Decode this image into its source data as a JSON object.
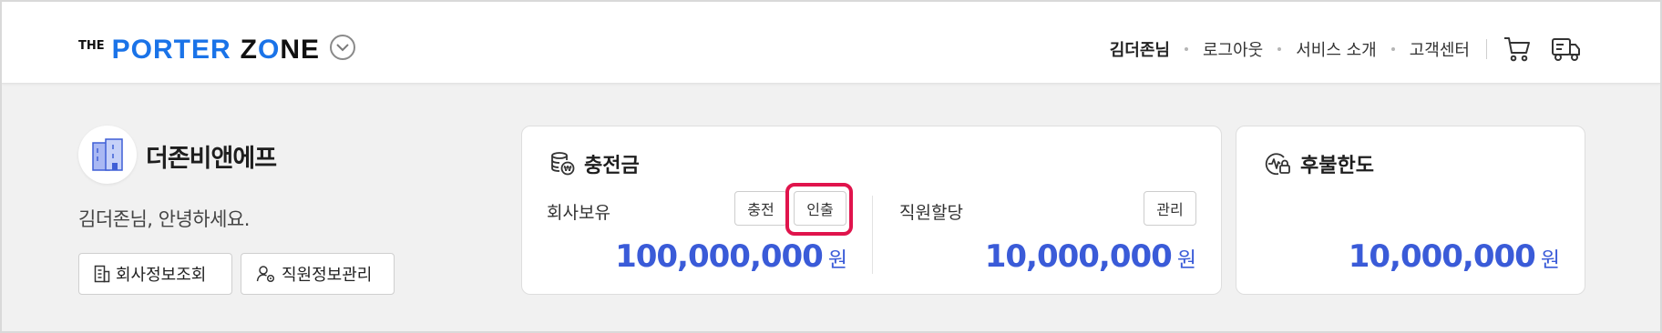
{
  "header": {
    "logo": {
      "the": "THE",
      "porter": "PORTER",
      "zone_z": "Z",
      "zone_o": "O",
      "zone_ne": "NE"
    },
    "nav": {
      "user_label": "김더존님",
      "logout_label": "로그아웃",
      "service_label": "서비스 소개",
      "support_label": "고객센터"
    },
    "icons": [
      "chevron-down-icon",
      "cart-icon",
      "delivery-truck-icon"
    ]
  },
  "profile": {
    "company_name": "더존비앤에프",
    "greeting": "김더존님, 안녕하세요.",
    "company_info_button": "회사정보조회",
    "staff_info_button": "직원정보관리"
  },
  "balance_card": {
    "title": "충전금",
    "company_label": "회사보유",
    "charge_button": "충전",
    "withdraw_button": "인출",
    "company_amount": "100,000,000",
    "company_unit": "원",
    "staff_label": "직원할당",
    "manage_button": "관리",
    "staff_amount": "10,000,000",
    "staff_unit": "원"
  },
  "credit_card": {
    "title": "후불한도",
    "amount": "10,000,000",
    "unit": "원"
  },
  "colors": {
    "brand_blue": "#1a73e8",
    "amount_blue": "#3a5bd8",
    "highlight_red": "#e0144c",
    "page_background": "#f1f1f1"
  }
}
